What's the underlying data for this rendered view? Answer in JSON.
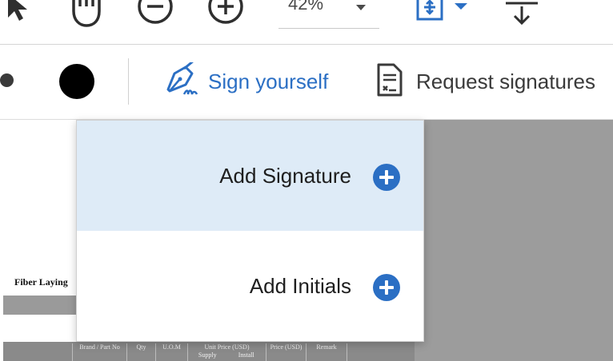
{
  "toolbar": {
    "zoom_value": "42%",
    "icons": {
      "select": "arrow-pointer-icon",
      "hand": "hand-pan-icon",
      "zoom_out": "zoom-out-icon",
      "zoom_in": "zoom-in-icon",
      "zoom_dropdown": "chevron-down-icon",
      "fit_page": "fit-page-icon",
      "scroll": "scroll-down-icon"
    }
  },
  "sign_toolbar": {
    "color_selected": "#000000",
    "sign_yourself_label": "Sign yourself",
    "request_signatures_label": "Request signatures",
    "accent": "#2b6fc4"
  },
  "sign_menu": {
    "items": [
      {
        "label": "Add Signature",
        "hovered": true
      },
      {
        "label": "Add Initials",
        "hovered": false
      }
    ],
    "hover_color": "#deebf7"
  },
  "document": {
    "heading": "Fiber Laying",
    "table_headers": {
      "brand": "Brand / Part No",
      "qty": "Qty",
      "uom": "U.O.M",
      "unit_price": "Unit Price (USD)",
      "unit_price_sub1": "Supply",
      "unit_price_sub2": "Install",
      "price": "Price (USD)",
      "remark": "Remark"
    }
  }
}
